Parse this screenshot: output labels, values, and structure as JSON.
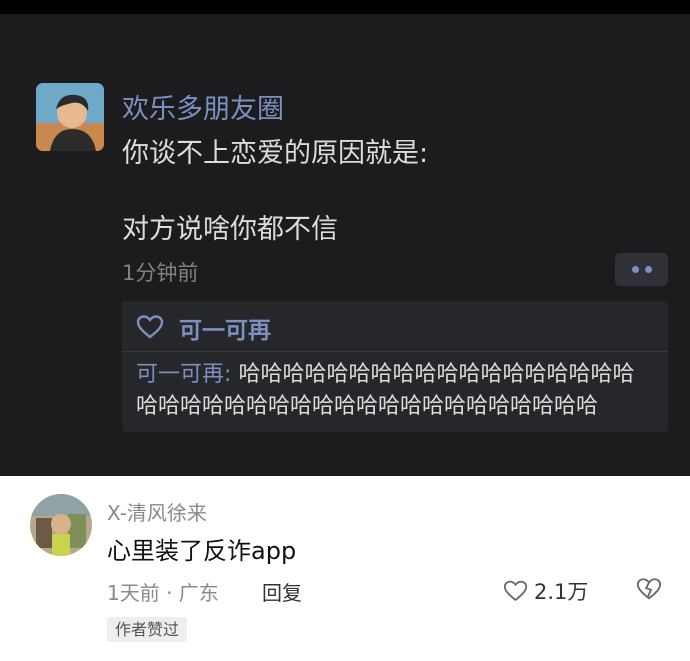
{
  "moment": {
    "poster_name": "欢乐多朋友圈",
    "text_line1": "你谈不上恋爱的原因就是:",
    "text_line2": "对方说啥你都不信",
    "time": "1分钟前",
    "likes": "可一可再",
    "reply_name": "可一可再",
    "reply_colon": ":",
    "reply_text": "哈哈哈哈哈哈哈哈哈哈哈哈哈哈哈哈哈哈哈哈哈哈哈哈哈哈哈哈哈哈哈哈哈哈哈哈哈哈哈"
  },
  "comment": {
    "username": "X-清风徐来",
    "text": "心里装了反诈app",
    "meta": "1天前 · 广东",
    "reply_label": "回复",
    "like_count": "2.1万",
    "author_badge": "作者赞过"
  },
  "colors": {
    "moment_bg": "#1c1c1e",
    "link_blue": "#7c8fbf",
    "panel_bg": "#26272b"
  }
}
